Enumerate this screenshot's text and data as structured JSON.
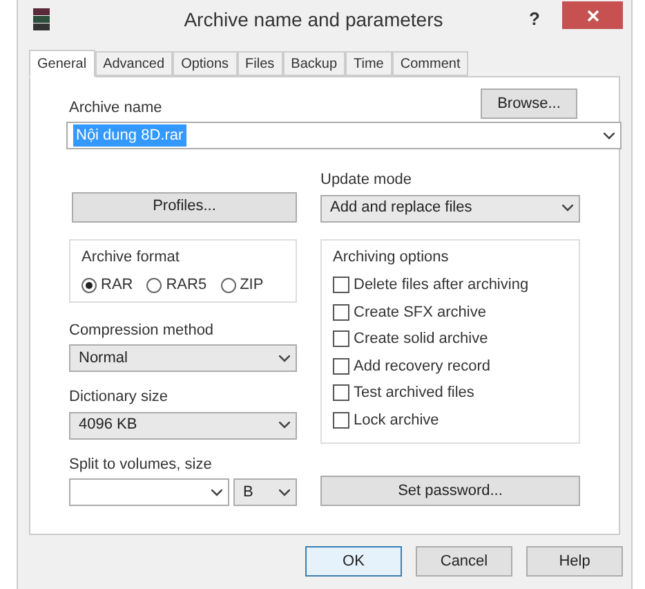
{
  "window": {
    "title": "Archive name and parameters",
    "help": "?"
  },
  "tabs": [
    {
      "label": "General",
      "selected": true
    },
    {
      "label": "Advanced",
      "selected": false
    },
    {
      "label": "Options",
      "selected": false
    },
    {
      "label": "Files",
      "selected": false
    },
    {
      "label": "Backup",
      "selected": false
    },
    {
      "label": "Time",
      "selected": false
    },
    {
      "label": "Comment",
      "selected": false
    }
  ],
  "archive_name": {
    "label": "Archive name",
    "value": "Nội dung 8D.rar",
    "browse": "Browse..."
  },
  "profiles": "Profiles...",
  "update_mode": {
    "label": "Update mode",
    "value": "Add and replace files"
  },
  "archive_format": {
    "label": "Archive format",
    "options": [
      {
        "label": "RAR",
        "selected": true
      },
      {
        "label": "RAR5",
        "selected": false
      },
      {
        "label": "ZIP",
        "selected": false
      }
    ]
  },
  "archiving_options": {
    "label": "Archiving options",
    "items": [
      {
        "label": "Delete files after archiving",
        "checked": false
      },
      {
        "label": "Create SFX archive",
        "checked": false
      },
      {
        "label": "Create solid archive",
        "checked": false
      },
      {
        "label": "Add recovery record",
        "checked": false
      },
      {
        "label": "Test archived files",
        "checked": false
      },
      {
        "label": "Lock archive",
        "checked": false
      }
    ]
  },
  "compression_method": {
    "label": "Compression method",
    "value": "Normal"
  },
  "dictionary_size": {
    "label": "Dictionary size",
    "value": "4096 KB"
  },
  "split": {
    "label": "Split to volumes, size",
    "unit": "B"
  },
  "set_password": "Set password...",
  "buttons": [
    "OK",
    "Cancel",
    "Help"
  ]
}
